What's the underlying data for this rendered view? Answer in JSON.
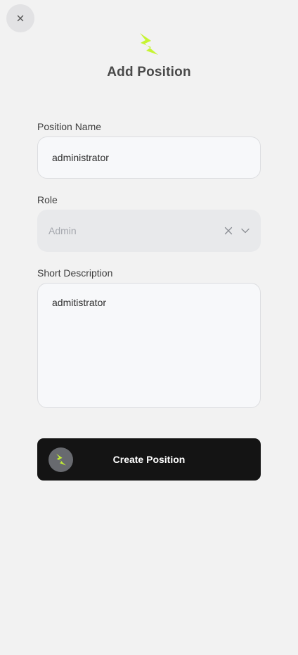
{
  "header": {
    "close_icon": "close-icon",
    "logo_icon": "lightning-bolt-icon",
    "title": "Add Position"
  },
  "form": {
    "position_name": {
      "label": "Position Name",
      "value": "administrator"
    },
    "role": {
      "label": "Role",
      "value": "Admin",
      "clear_icon": "clear-icon",
      "dropdown_icon": "chevron-down-icon"
    },
    "short_description": {
      "label": "Short Description",
      "value": "admitistrator"
    },
    "submit": {
      "label": "Create Position",
      "icon": "lightning-bolt-icon"
    }
  },
  "colors": {
    "accent": "#c6f432",
    "background": "#f2f2f2",
    "button": "#141414"
  }
}
